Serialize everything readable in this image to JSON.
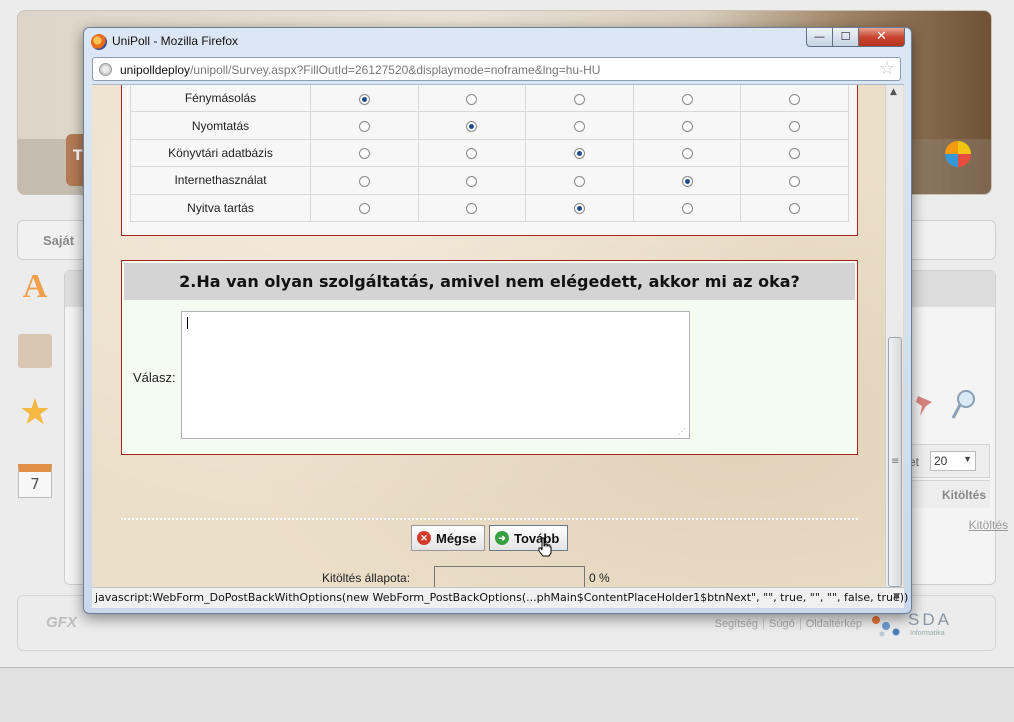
{
  "background": {
    "nav_label": "Saját",
    "tab_letter": "T",
    "calendar_day": "7",
    "pager_prefix": "et",
    "pager_value": "20",
    "column_header": "Kitöltés",
    "column_link": "Kitöltés",
    "footer_logo": "GFX",
    "footer_links": [
      "Segítség",
      "Súgó",
      "Oldaltérkép"
    ],
    "brand_letters": "SDA",
    "brand_sub": "Informatika"
  },
  "window": {
    "title": "UniPoll - Mozilla Firefox",
    "url_domain": "unipolldeploy",
    "url_path": "/unipoll/Survey.aspx?FillOutId=26127520&displaymode=noframe&lng=hu-HU",
    "controls": {
      "minimize": "—",
      "maximize": "☐",
      "close": "✕"
    }
  },
  "question1": {
    "rows": [
      {
        "label": "Fénymásolás",
        "selected": 0
      },
      {
        "label": "Nyomtatás",
        "selected": 1
      },
      {
        "label": "Könyvtári adatbázis",
        "selected": 2
      },
      {
        "label": "Internethasználat",
        "selected": 3
      },
      {
        "label": "Nyitva tartás",
        "selected": 2
      }
    ],
    "option_count": 5
  },
  "question2": {
    "title": "2.Ha van olyan szolgáltatás, amivel nem elégedett, akkor mi az oka?",
    "answer_label": "Válasz:",
    "answer_value": ""
  },
  "buttons": {
    "cancel": "Mégse",
    "next": "Tovább"
  },
  "progress": {
    "label": "Kitöltés állapota:",
    "value_text": "0 %",
    "fraction": 0
  },
  "status_bar": "javascript:WebForm_DoPostBackWithOptions(new WebForm_PostBackOptions(...phMain$ContentPlaceHolder1$btnNext\", \"\", true, \"\", \"\", false, true))",
  "colors": {
    "accent_border": "#a8231c",
    "answer_bg": "#f4fbf1",
    "radio_selected": "#1f4d8a",
    "cancel_icon": "#d23a2b",
    "next_icon": "#37a041"
  },
  "icons": [
    "firefox-icon",
    "globe-icon",
    "bookmark-star-icon",
    "cancel-icon",
    "next-icon",
    "hand-cursor-icon"
  ]
}
